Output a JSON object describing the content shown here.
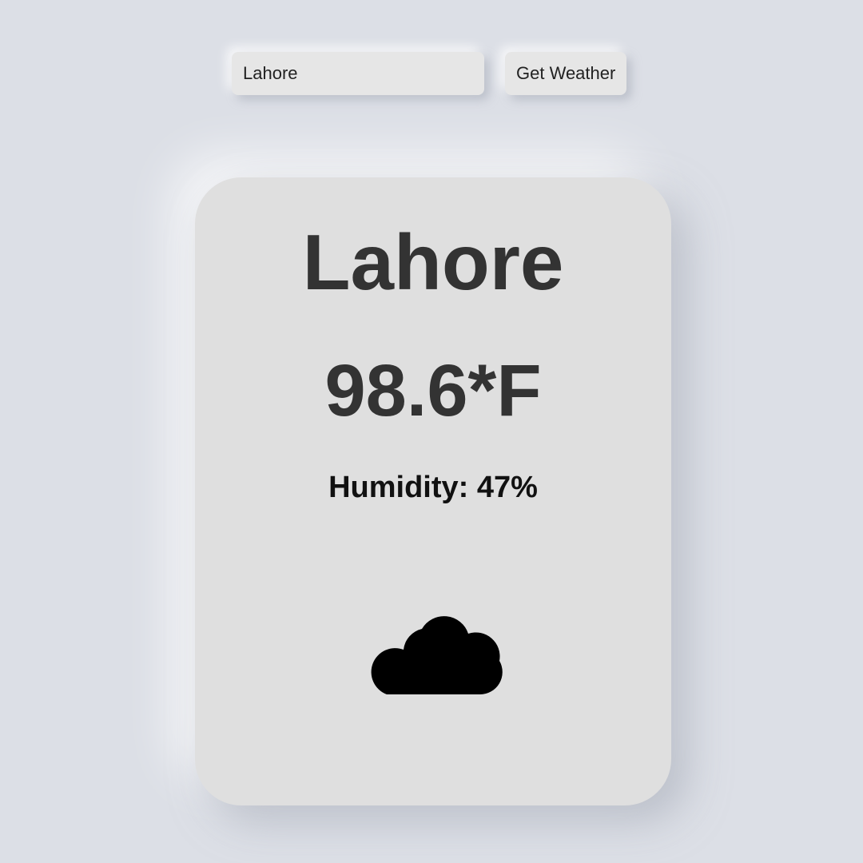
{
  "search": {
    "value": "Lahore",
    "button_label": "Get Weather"
  },
  "weather": {
    "city": "Lahore",
    "temperature": "98.6*F",
    "humidity": "Humidity: 47%",
    "icon": "cloud-icon"
  },
  "colors": {
    "background": "#dcdfe6",
    "card": "#dfdfdf",
    "text_dark": "#333333"
  }
}
